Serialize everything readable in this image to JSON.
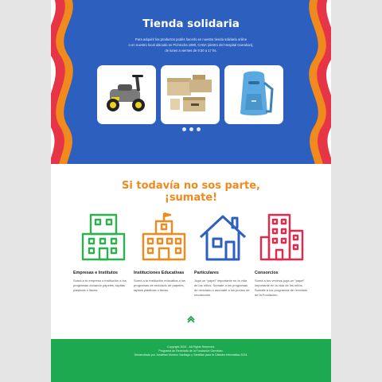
{
  "hero": {
    "title": "Tienda solidaria",
    "description": [
      "Para adquirir los productos podés hacerlo en nuestra tienda solidaria online",
      "o en nuestro local ubicado en Pichincha 1890, CABA (dentro del Hospital Garrahan),",
      "de lunes a viernes de 9:30 a 17 hs."
    ],
    "products": [
      "ride-on toy car",
      "cardboard boxes",
      "blue backpack"
    ],
    "carousel_dots": 3
  },
  "join": {
    "title_line1": "Si todavía no sos parte,",
    "title_line2": "¡sumate!"
  },
  "categories": [
    {
      "title": "Empresas e Institutos",
      "text": "Sumá a tu empresa o institución a los programas donando papeles, tapitas plásticas o llaves.",
      "icon": "office-building-icon",
      "color": "#2bb24c"
    },
    {
      "title": "Instituciones Educativas",
      "text": "Sumá a tu institución educativa a los programas de reciclado de papeles, tapitas plásticas o llaves.",
      "icon": "school-icon",
      "color": "#f08a1c"
    },
    {
      "title": "Particulares",
      "text": "Jugá un “papel” importante en la vida de los niños. Sumate a los programas de reciclado o asomate a los puntos de recolección.",
      "icon": "house-icon",
      "color": "#2c5fbe"
    },
    {
      "title": "Consorcios",
      "text": "Sumá a tus vecinos jugá un “papel” importante en la vida de los niños. Sumate a los programas de reciclado de la Fundación.",
      "icon": "apartment-building-icon",
      "color": "#e22b4b"
    }
  ],
  "footer": {
    "lines": [
      "Copyright 2024 - All Rights Reserved.",
      "Programa de Reciclado de la Fundación Garrahan.",
      "Desarrollado por Jonathan Moreno Santiago y Santillán para la Cátedra Informática 2024."
    ]
  },
  "colors": {
    "hero_bg": "#2c5fbe",
    "wave_red": "#e63546",
    "wave_orange": "#f08a1c",
    "accent_orange": "#f08a1c",
    "footer_green": "#1da94f"
  }
}
